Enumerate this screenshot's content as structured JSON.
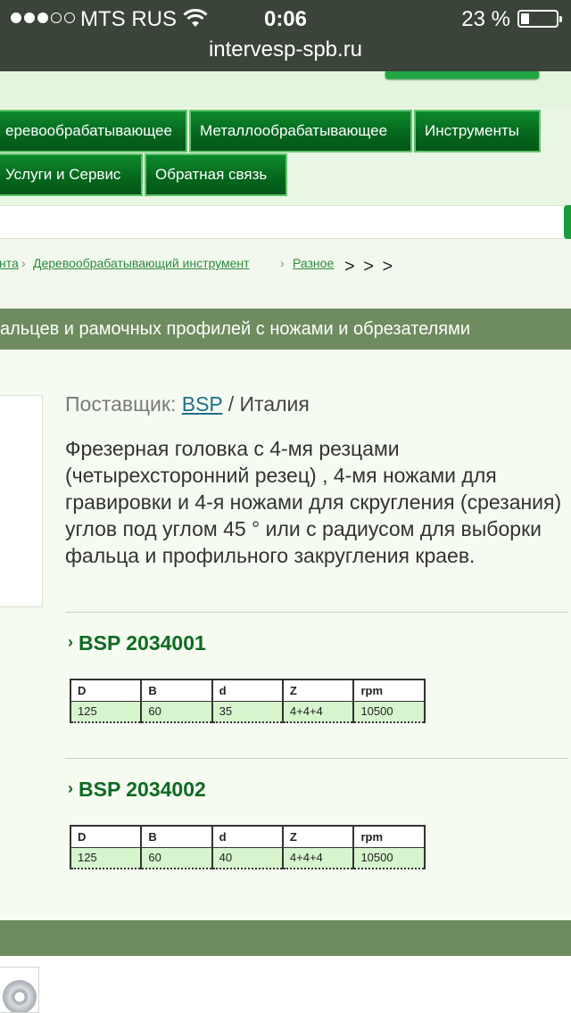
{
  "status_bar": {
    "carrier": "MTS RUS",
    "time": "0:06",
    "battery_percent": "23 %",
    "battery_level": 0.23,
    "signal_filled": 3,
    "signal_total": 5
  },
  "browser": {
    "url": "intervesp-spb.ru"
  },
  "nav": {
    "items": [
      {
        "label": "еревообрабатывающее"
      },
      {
        "label": "Металлообрабатывающее"
      },
      {
        "label": "Инструменты"
      },
      {
        "label": "Услуги и Сервис"
      },
      {
        "label": "Обратная связь"
      }
    ]
  },
  "breadcrumb": {
    "items": [
      {
        "label": "нта"
      },
      {
        "label": "Деревообрабатывающий инструмент"
      },
      {
        "label": "Разное"
      }
    ],
    "separator": "›",
    "trail": "> > >"
  },
  "page": {
    "title": "альцев и рамочных профилей с ножами и обрезателями"
  },
  "supplier": {
    "label": "Поставщик:",
    "brand": "BSP",
    "separator": "/",
    "country": "Италия"
  },
  "description": "Фрезерная головка с 4-мя резцами (четырехсторонний резец) , 4-мя ножами для гравировки и 4-я ножами для скругления (срезания) углов под углом 45 ° или с радиусом для выборки фальца и профильного закругления краев.",
  "products": [
    {
      "title": "BSP 2034001",
      "chevron": "›",
      "headers": [
        "D",
        "B",
        "d",
        "Z",
        "rpm"
      ],
      "values": [
        "125",
        "60",
        "35",
        "4+4+4",
        "10500"
      ]
    },
    {
      "title": "BSP 2034002",
      "chevron": "›",
      "headers": [
        "D",
        "B",
        "d",
        "Z",
        "rpm"
      ],
      "values": [
        "125",
        "60",
        "40",
        "4+4+4",
        "10500"
      ]
    }
  ],
  "colors": {
    "status_bg": "#3a4438",
    "nav_green": "#05661d",
    "title_band": "#6e8c5f",
    "product_title": "#0e6a22",
    "table_row": "#d6f5cd"
  }
}
